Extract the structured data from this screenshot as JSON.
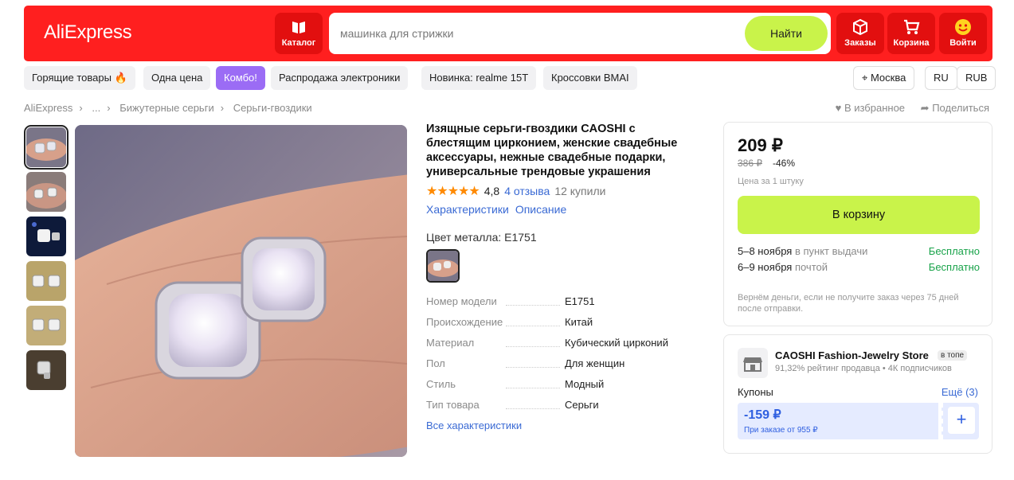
{
  "header": {
    "logo": "AliExpress",
    "catalog_label": "Каталог",
    "search_placeholder": "машинка для стрижки",
    "search_button": "Найти",
    "orders_label": "Заказы",
    "cart_label": "Корзина",
    "login_label": "Войти",
    "brand_color": "#ff1f1f",
    "accent_color": "#c9f34a"
  },
  "chips": [
    "Горящие товары 🔥",
    "Одна цена",
    "Комбо!",
    "Распродажа электроники",
    "Новинка: realme 15T",
    "Кроссовки BMAI"
  ],
  "locale": {
    "city": "Москва",
    "lang": "RU",
    "currency": "RUB"
  },
  "breadcrumbs": [
    "AliExpress",
    "...",
    "Бижутерные серьги",
    "Серьги-гвоздики"
  ],
  "actions": {
    "favorite": "В избранное",
    "share": "Поделиться"
  },
  "product": {
    "title": "Изящные серьги-гвоздики CAOSHI с блестящим цирконием, женские свадебные аксессуары, нежные свадебные подарки, универсальные трендовые украшения",
    "stars": "★★★★★",
    "rating": "4,8",
    "reviews": "4 отзыва",
    "bought": "12 купили",
    "tab_specs": "Характеристики",
    "tab_desc": "Описание",
    "metal_label": "Цвет металла: E1751",
    "specs": [
      {
        "k": "Номер модели",
        "v": "E1751"
      },
      {
        "k": "Происхождение",
        "v": "Китай"
      },
      {
        "k": "Материал",
        "v": "Кубический цирконий"
      },
      {
        "k": "Пол",
        "v": "Для женщин"
      },
      {
        "k": "Стиль",
        "v": "Модный"
      },
      {
        "k": "Тип товара",
        "v": "Серьги"
      }
    ],
    "all_specs": "Все характеристики"
  },
  "price_card": {
    "price": "209 ₽",
    "old_price": "386 ₽",
    "discount": "-46%",
    "unit": "Цена за 1 штуку",
    "cart_button": "В корзину",
    "delivery": [
      {
        "date": "5–8 ноября",
        "method": "в пункт выдачи",
        "cost": "Бесплатно"
      },
      {
        "date": "6–9 ноября",
        "method": "почтой",
        "cost": "Бесплатно"
      }
    ],
    "refund": "Вернём деньги, если не получите заказ через 75 дней после отправки."
  },
  "store": {
    "name": "CAOSHI Fashion-Jewelry Store",
    "badge": "в топе",
    "sub": "91,32% рейтинг продавца • 4К подписчиков",
    "coupons_label": "Купоны",
    "more": "Ещё (3)",
    "coupon_amount": "-159 ₽",
    "coupon_cond": "При заказе от 955 ₽"
  }
}
